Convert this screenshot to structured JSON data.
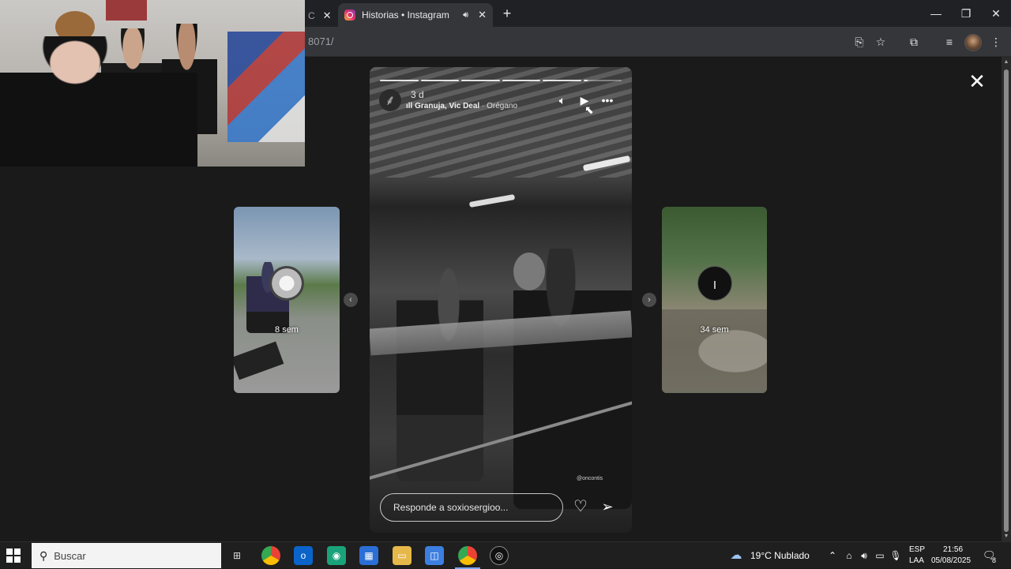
{
  "browser": {
    "tabs": [
      {
        "label": "C",
        "partial": true
      },
      {
        "label": "Historias • Instagram",
        "active": true
      }
    ],
    "url_fragment": "8071/"
  },
  "story": {
    "main": {
      "time_ago": "3 d",
      "music_artist": "Granuja, Vic Deal",
      "music_separator": " · ",
      "music_track": "Orégano",
      "reply_placeholder": "Responde a soxiosergioo...",
      "watermark": "@oncontis",
      "progress_segments": 6,
      "progress_current_index": 5
    },
    "previous": {
      "time_ago": "8 sem"
    },
    "next": {
      "time_ago": "34 sem"
    }
  },
  "taskbar": {
    "search_placeholder": "Buscar",
    "weather": "19°C  Nublado",
    "language_top": "ESP",
    "language_bottom": "LAA",
    "time": "21:56",
    "date": "05/08/2025",
    "notification_count": "8"
  },
  "colors": {
    "tab_bar": "#202124",
    "toolbar": "#35363a",
    "viewer_bg": "#1a1a1a",
    "taskbar": "#1f1f1f"
  }
}
